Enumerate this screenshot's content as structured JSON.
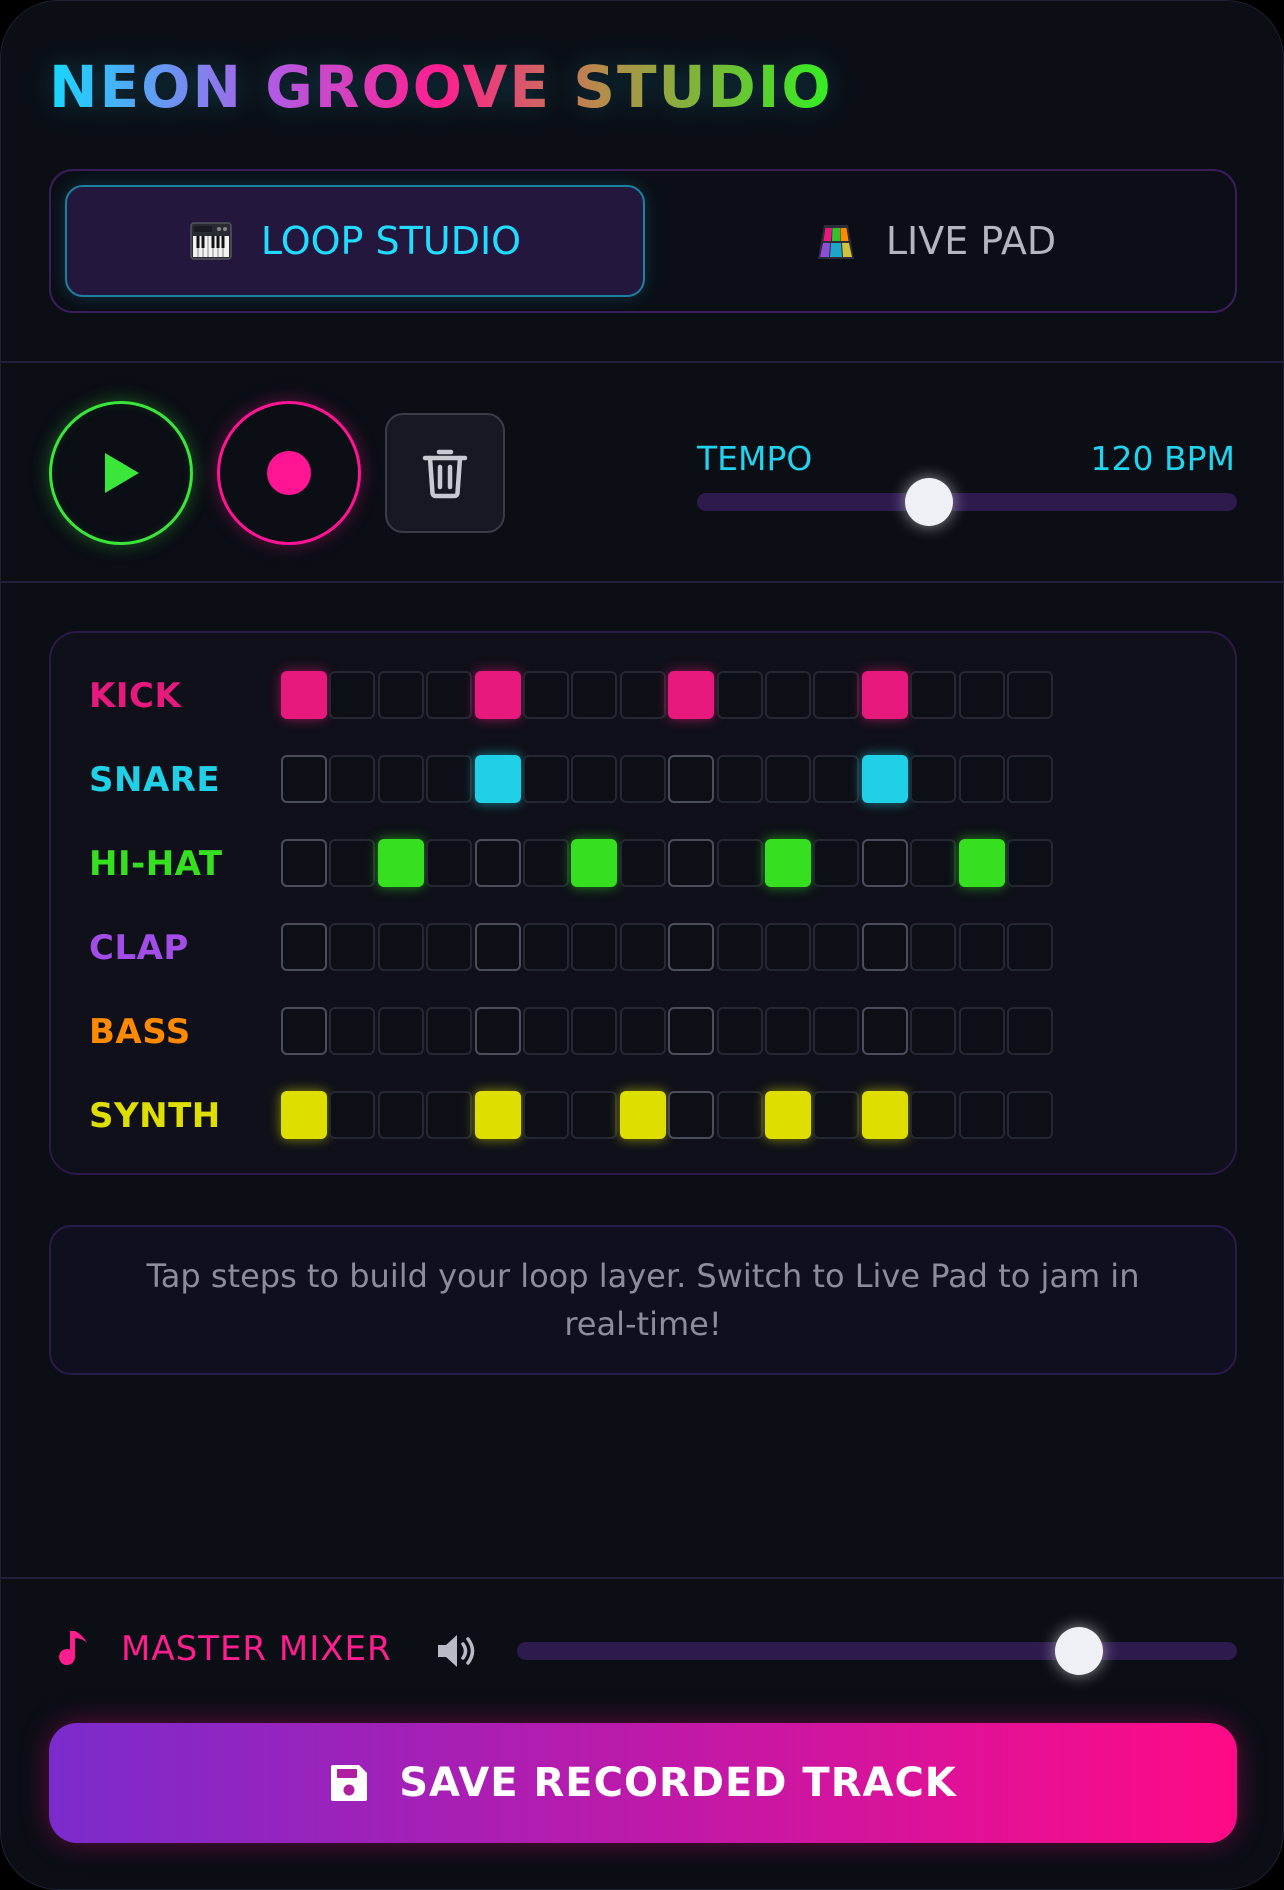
{
  "app": {
    "title": "NEON GROOVE STUDIO"
  },
  "tabs": [
    {
      "label": "LOOP STUDIO",
      "icon": "piano-keyboard-icon",
      "active": true
    },
    {
      "label": "LIVE PAD",
      "icon": "pad-grid-icon",
      "active": false
    }
  ],
  "transport": {
    "play_icon": "play-icon",
    "record_icon": "record-icon",
    "clear_icon": "trash-icon",
    "tempo_label": "TEMPO",
    "tempo_value": "120 BPM",
    "tempo_fraction": 0.43
  },
  "colors": {
    "background": "#0b0e15",
    "kick": "#e8197c",
    "snare": "#1fd0e6",
    "hihat": "#36e020",
    "clap": "#a34de8",
    "bass": "#ff8a00",
    "synth": "#dede00",
    "accent_pink": "#ff1e8e",
    "accent_cyan": "#22d3ee"
  },
  "sequencer": {
    "steps_per_row": 16,
    "rows": [
      {
        "label": "KICK",
        "color": "#e8197c",
        "active_steps": [
          0,
          4,
          8,
          12
        ]
      },
      {
        "label": "SNARE",
        "color": "#1fd0e6",
        "active_steps": [
          4,
          12
        ]
      },
      {
        "label": "HI-HAT",
        "color": "#36e020",
        "active_steps": [
          2,
          6,
          10,
          14
        ]
      },
      {
        "label": "CLAP",
        "color": "#a34de8",
        "active_steps": []
      },
      {
        "label": "BASS",
        "color": "#ff8a00",
        "active_steps": []
      },
      {
        "label": "SYNTH",
        "color": "#dede00",
        "active_steps": [
          0,
          4,
          7,
          10,
          12
        ]
      }
    ]
  },
  "hint": "Tap steps to build your loop layer. Switch to Live Pad to jam in real-time!",
  "mixer": {
    "icon": "music-note-icon",
    "label": "MASTER MIXER",
    "volume_icon": "speaker-icon",
    "volume_fraction": 0.78
  },
  "save": {
    "icon": "floppy-disk-icon",
    "label": "SAVE RECORDED TRACK"
  }
}
